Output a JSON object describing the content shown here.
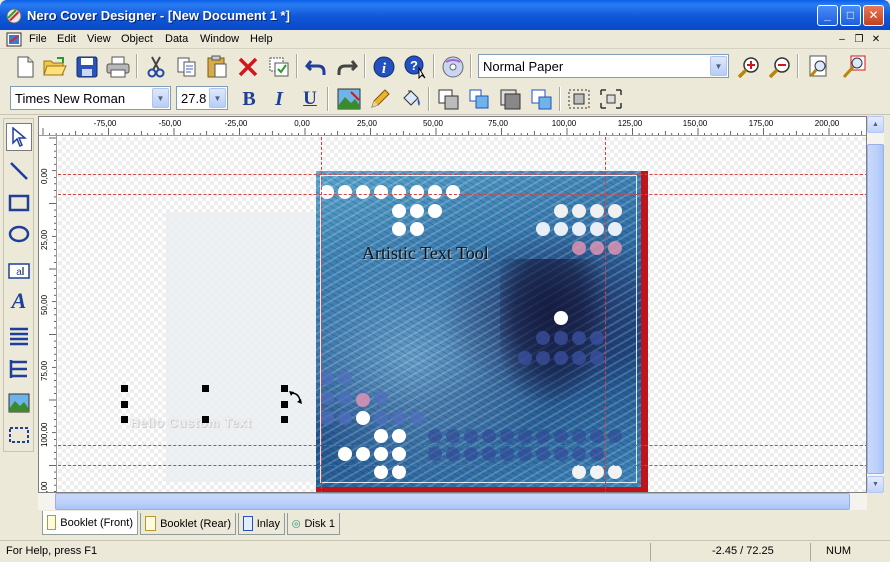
{
  "window": {
    "title": "Nero Cover Designer - [New Document 1 *]",
    "minimize_icon": "minimize-icon",
    "maximize_icon": "maximize-icon",
    "close_icon": "close-icon"
  },
  "menu": {
    "items": [
      "File",
      "Edit",
      "View",
      "Object",
      "Data",
      "Window",
      "Help"
    ]
  },
  "toolbar": {
    "paper_select": "Normal Paper",
    "font_select": "Times New Roman",
    "size_select": "27.8",
    "bold_label": "B",
    "italic_label": "I",
    "underline_label": "U"
  },
  "ruler": {
    "h_labels": [
      "-75,00",
      "-50,00",
      "-25,00",
      "0,00",
      "25,00",
      "50,00",
      "75,00",
      "100,00",
      "125,00",
      "150,00",
      "175,00",
      "200,00"
    ],
    "v_labels": [
      "0,00",
      "25,00",
      "50,00",
      "75,00",
      "100,00",
      "125,00"
    ]
  },
  "canvas": {
    "artistic_text": "Artistic Text Tool",
    "selected_text": "Hello Custom Text",
    "accent_red": "#c0141c",
    "guide_color": "#d94040"
  },
  "tabs": [
    {
      "label": "Booklet  (Front)"
    },
    {
      "label": "Booklet  (Rear)"
    },
    {
      "label": "Inlay"
    },
    {
      "label": "Disk 1"
    }
  ],
  "status": {
    "help": "For Help, press F1",
    "coords": "-2.45 / 72.25",
    "num": "NUM"
  }
}
